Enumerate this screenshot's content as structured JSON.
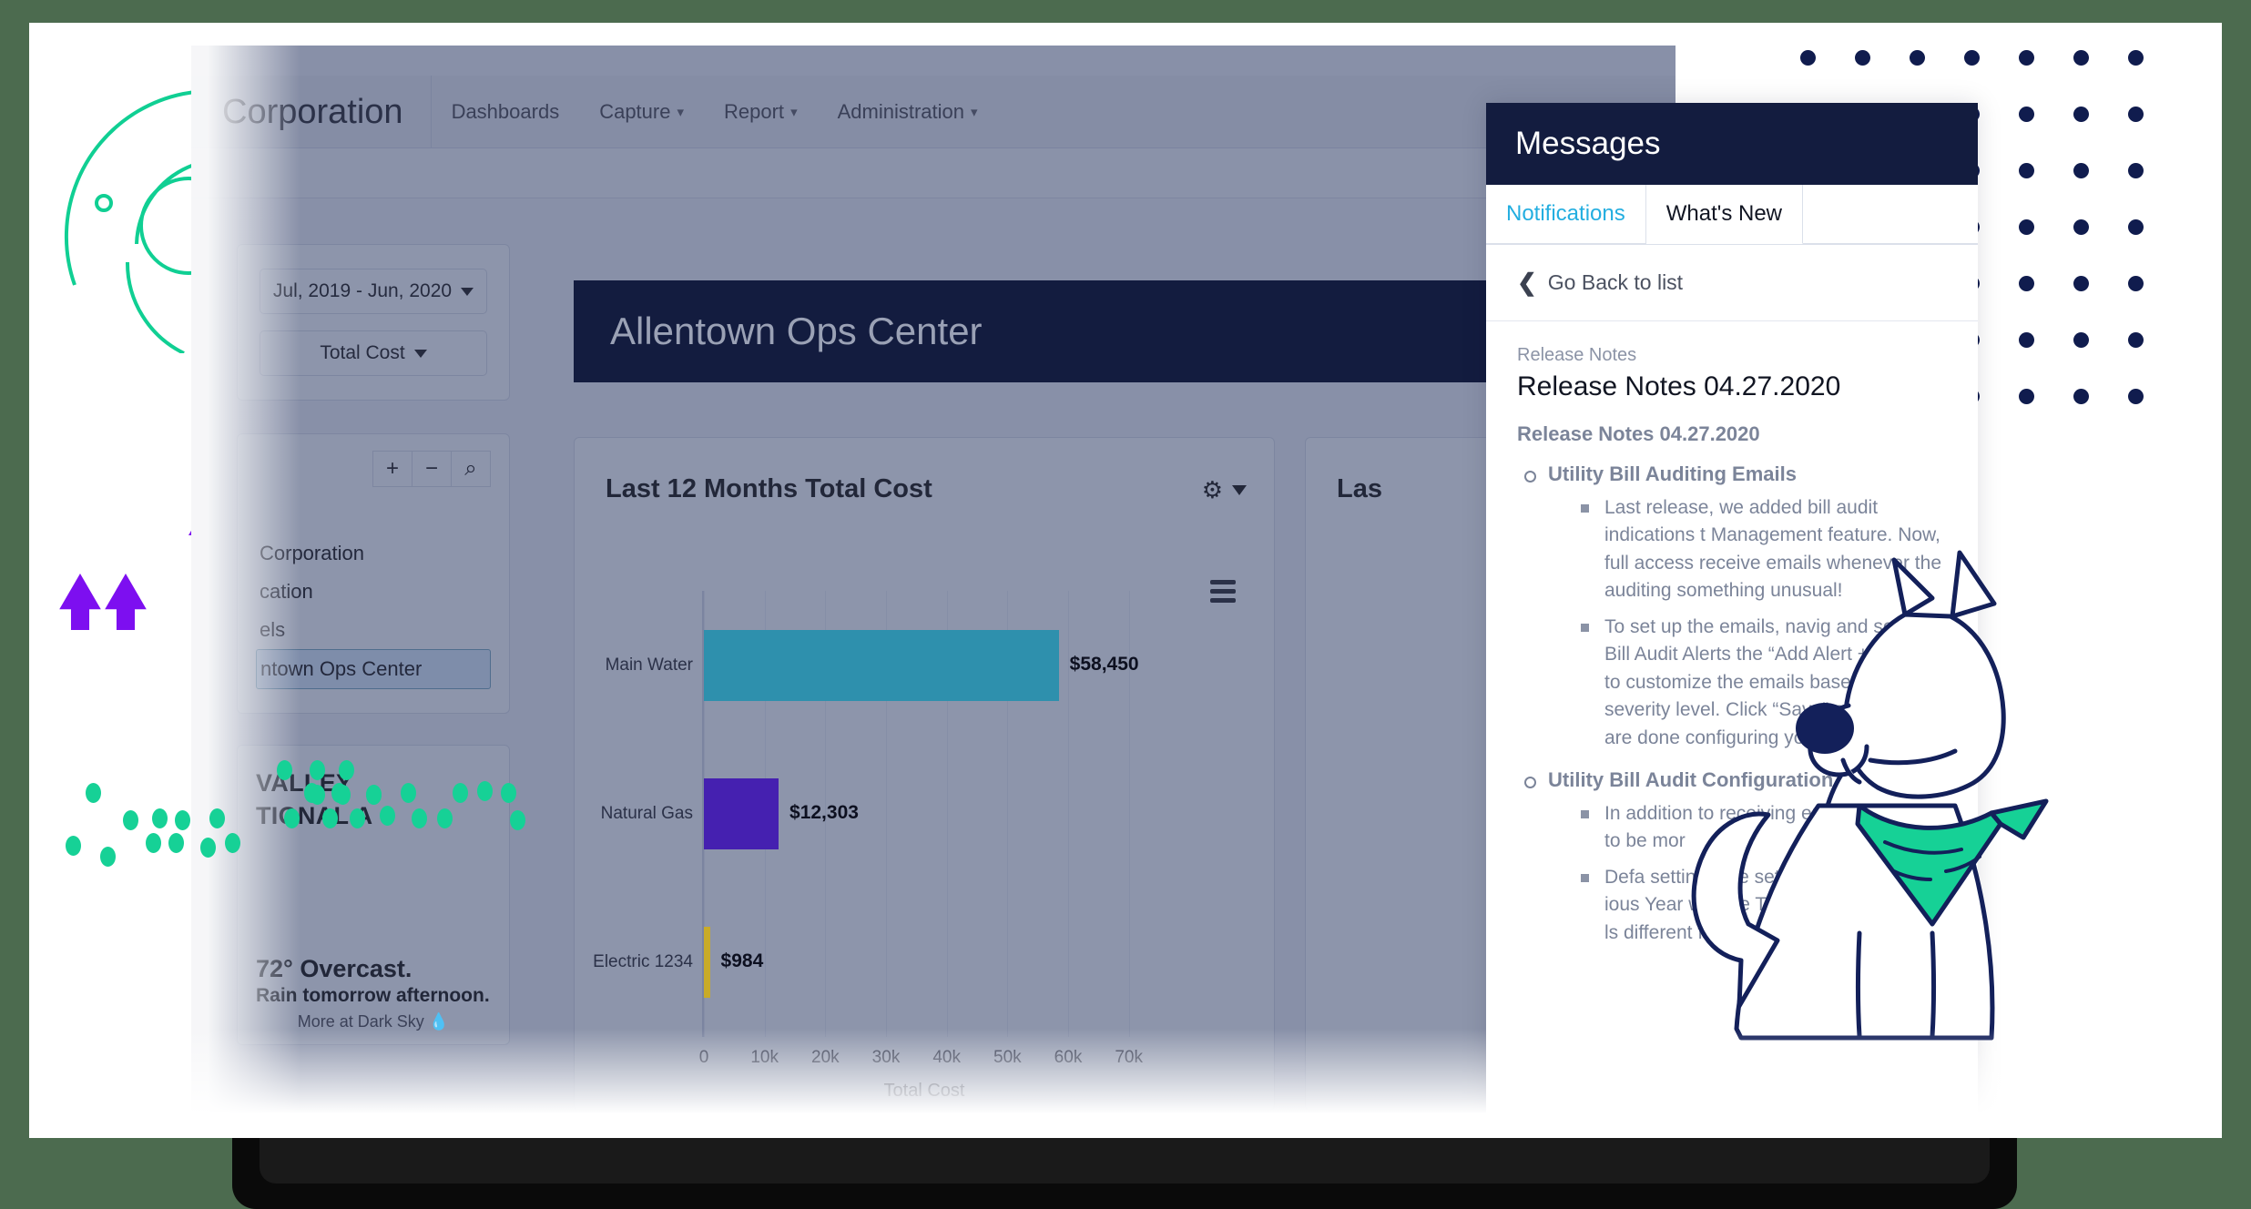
{
  "app": {
    "brand": "Corporation",
    "nav": [
      {
        "label": "Dashboards",
        "caret": false
      },
      {
        "label": "Capture",
        "caret": true
      },
      {
        "label": "Report",
        "caret": true
      },
      {
        "label": "Administration",
        "caret": true
      }
    ]
  },
  "filters": {
    "date_range": "Jul, 2019 - Jun, 2020",
    "measure": "Total Cost"
  },
  "tree": {
    "tools": [
      {
        "name": "expand-all",
        "glyph": "+"
      },
      {
        "name": "collapse-all",
        "glyph": "−"
      },
      {
        "name": "search",
        "glyph": "⌕"
      }
    ],
    "items": [
      {
        "label": "Corporation",
        "selected": false
      },
      {
        "label": "cation",
        "selected": false
      },
      {
        "label": "els",
        "selected": false
      },
      {
        "label": "ntown Ops Center",
        "selected": true
      }
    ]
  },
  "weather": {
    "station_line1": "VALLEY",
    "station_line2": "TIONAL A",
    "temp": "72° Overcast.",
    "forecast": "Rain tomorrow afternoon.",
    "attribution": "More at Dark Sky"
  },
  "hero": {
    "title": "Allentown Ops Center"
  },
  "cards": {
    "main_title": "Last 12 Months Total Cost",
    "right_title": "Las",
    "gear_icon": "gear-icon",
    "menu_icon": "hamburger-icon"
  },
  "chart_data": {
    "type": "bar",
    "orientation": "horizontal",
    "title": "Last 12 Months Total Cost",
    "xlabel": "Total Cost",
    "ylabel": "",
    "categories": [
      "Main Water",
      "Natural Gas",
      "Electric 1234"
    ],
    "values": [
      58450,
      12303,
      984
    ],
    "value_labels": [
      "$58,450",
      "$12,303",
      "$984"
    ],
    "colors": [
      "#2e90ad",
      "#4520b0",
      "#c9ab28"
    ],
    "xlim": [
      0,
      75000
    ],
    "xticks": [
      0,
      10000,
      20000,
      30000,
      40000,
      50000,
      60000,
      70000
    ],
    "xtick_labels": [
      "0",
      "10k",
      "20k",
      "30k",
      "40k",
      "50k",
      "60k",
      "70k"
    ],
    "grid": true,
    "legend": "none"
  },
  "messages": {
    "title": "Messages",
    "tabs": [
      {
        "label": "Notifications",
        "active": false
      },
      {
        "label": "What's New",
        "active": true
      }
    ],
    "go_back": "Go Back to list",
    "kicker": "Release Notes",
    "heading": "Release Notes 04.27.2020",
    "subheading": "Release Notes 04.27.2020",
    "sections": [
      {
        "heading": "Utility Bill Auditing Emails",
        "bullets": [
          "Last release, we added bill audit indications t Management feature. Now, full access receive emails whenever the auditing something unusual!",
          "To set up the emails, navig and select Bill Audit Alerts the “Add Alert +” button to customize the emails based on mete severity level. Click “Save” at the b you are done configuring your aler"
        ]
      },
      {
        "heading": "Utility Bill Audit Configuration",
        "bullets": [
          "In addition to receiving em on bill audits to be mor",
          "Defa settings are setti s for each the ious Year when e Total C er bills; yo adj t ls different fr"
        ]
      }
    ]
  },
  "colors": {
    "navy": "#131c3f",
    "teal": "#16d196",
    "purple": "#7d0ff0",
    "accent_blue": "#23aee0",
    "app_bg": "#8890a8"
  }
}
